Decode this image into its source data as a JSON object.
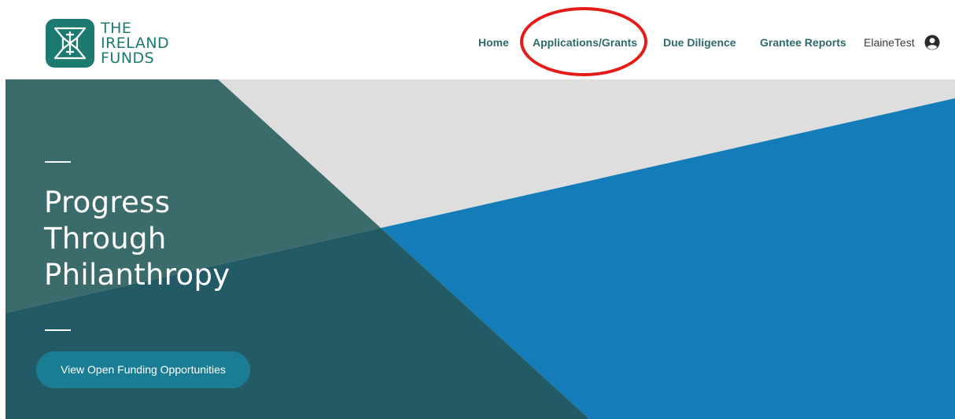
{
  "logo": {
    "lines": [
      "THE",
      "IRELAND",
      "FUNDS"
    ],
    "icon": "ireland-funds-logo-icon",
    "color": "#1c7a71"
  },
  "nav": {
    "home": "Home",
    "applications": "Applications/Grants",
    "due_diligence": "Due Diligence",
    "grantee_reports": "Grantee Reports",
    "user": "ElaineTest",
    "user_icon": "user-circle-icon"
  },
  "hero": {
    "tagline": [
      "Progress",
      "Through",
      "Philanthropy"
    ],
    "cta_label": "View Open Funding Opportunities",
    "colors": {
      "teal": "#3c6b6b",
      "dark_teal": "#225a65",
      "blue": "#147cb8",
      "grey": "#dedede",
      "button": "#1a7d93"
    }
  },
  "annotation": {
    "color": "#e41b17",
    "highlights": "Applications/Grants"
  }
}
